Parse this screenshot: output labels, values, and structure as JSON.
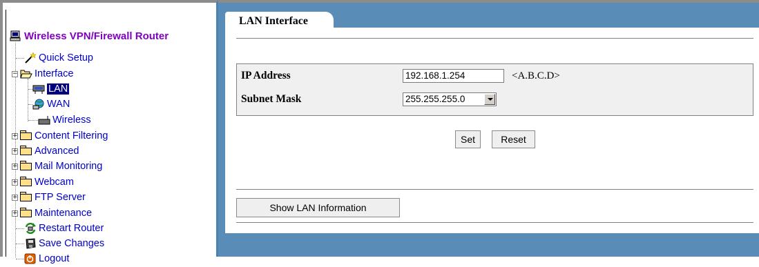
{
  "nav": {
    "title": "Wireless VPN/Firewall Router",
    "items": [
      {
        "label": "Quick Setup",
        "icon": "wand-icon"
      },
      {
        "label": "Interface",
        "icon": "folder-open-icon"
      },
      {
        "label": "LAN",
        "icon": "lan-icon",
        "selected": true
      },
      {
        "label": "WAN",
        "icon": "wan-icon"
      },
      {
        "label": "Wireless",
        "icon": "wireless-icon"
      },
      {
        "label": "Content Filtering",
        "icon": "folder-icon"
      },
      {
        "label": "Advanced",
        "icon": "folder-icon"
      },
      {
        "label": "Mail Monitoring",
        "icon": "folder-icon"
      },
      {
        "label": "Webcam",
        "icon": "folder-icon"
      },
      {
        "label": "FTP Server",
        "icon": "folder-icon"
      },
      {
        "label": "Maintenance",
        "icon": "folder-icon"
      },
      {
        "label": "Restart Router",
        "icon": "restart-icon"
      },
      {
        "label": "Save Changes",
        "icon": "save-icon"
      },
      {
        "label": "Logout",
        "icon": "logout-icon"
      }
    ]
  },
  "main": {
    "tab_label": "LAN Interface",
    "ip_label": "IP Address",
    "ip_value": "192.168.1.254",
    "ip_hint": "<A.B.C.D>",
    "mask_label": "Subnet Mask",
    "mask_value": "255.255.255.0",
    "set_label": "Set",
    "reset_label": "Reset",
    "show_info_label": "Show LAN Information"
  },
  "colors": {
    "panel_blue": "#5a8cb8",
    "nav_link": "#0000cc",
    "nav_title": "#8000c0"
  }
}
